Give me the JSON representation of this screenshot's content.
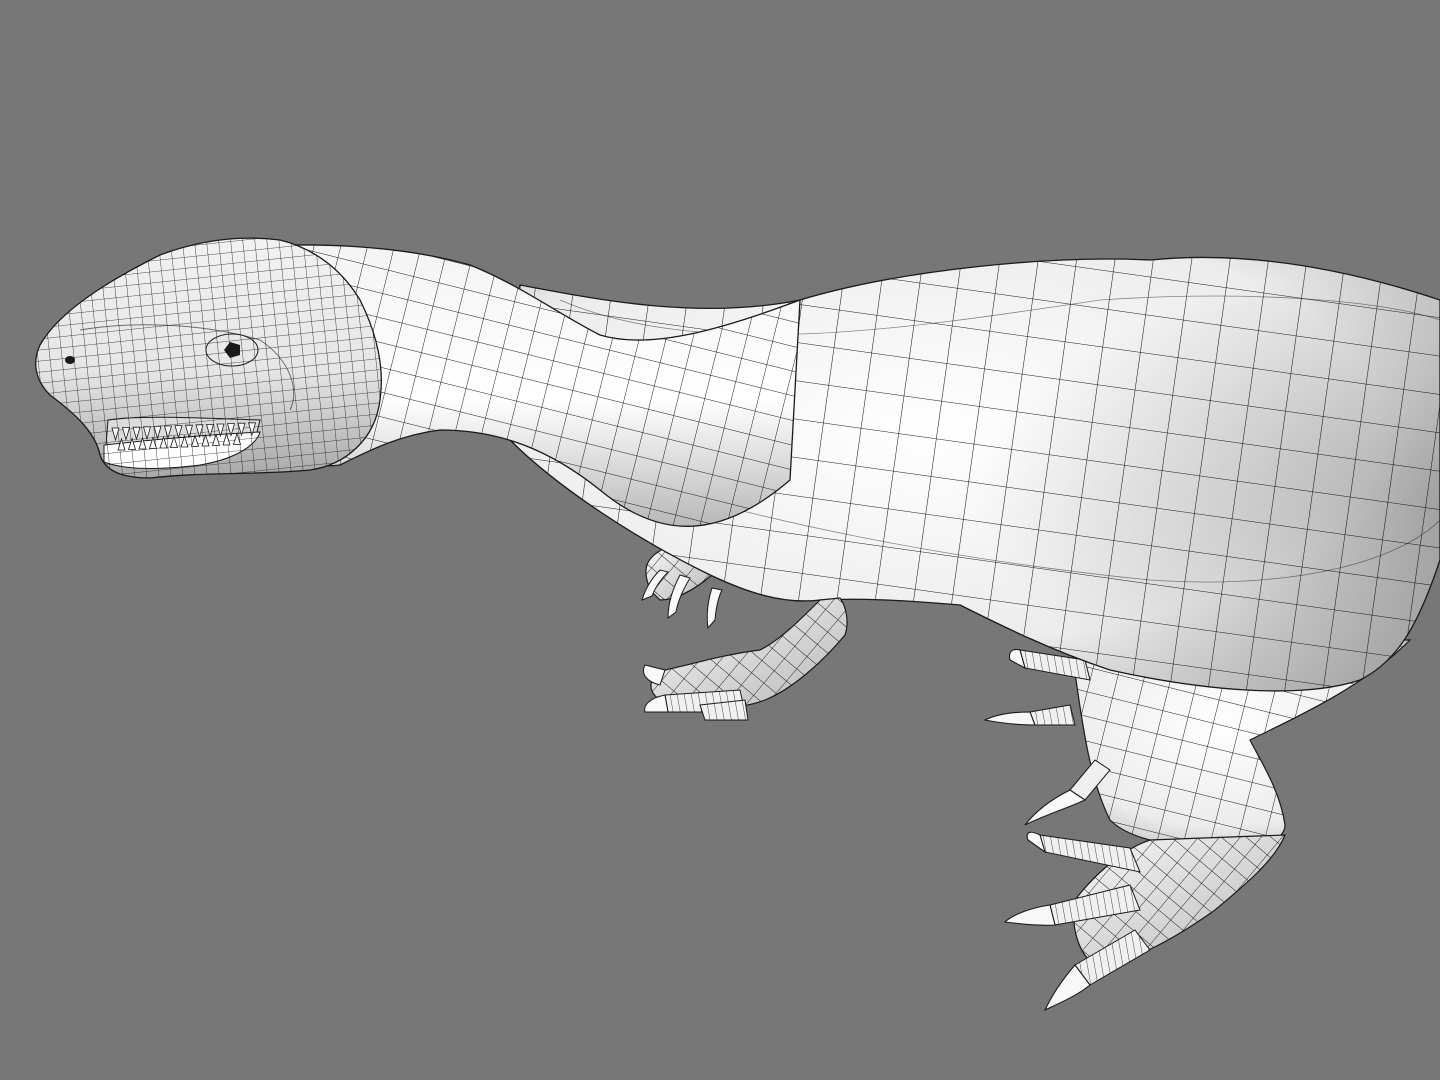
{
  "viewport": {
    "background_color": "#777777",
    "mesh_fill_color": "#f4f4f4",
    "mesh_shadow_color": "#b4b4b4",
    "wire_color": "#1a1a1a"
  },
  "model": {
    "subject": "dinosaur-wireframe-mesh",
    "topology": "quad-grid",
    "parts": [
      "head",
      "eye",
      "jaw",
      "teeth",
      "neck",
      "torso",
      "left-arm",
      "right-arm",
      "hind-leg",
      "foot",
      "claws"
    ]
  }
}
